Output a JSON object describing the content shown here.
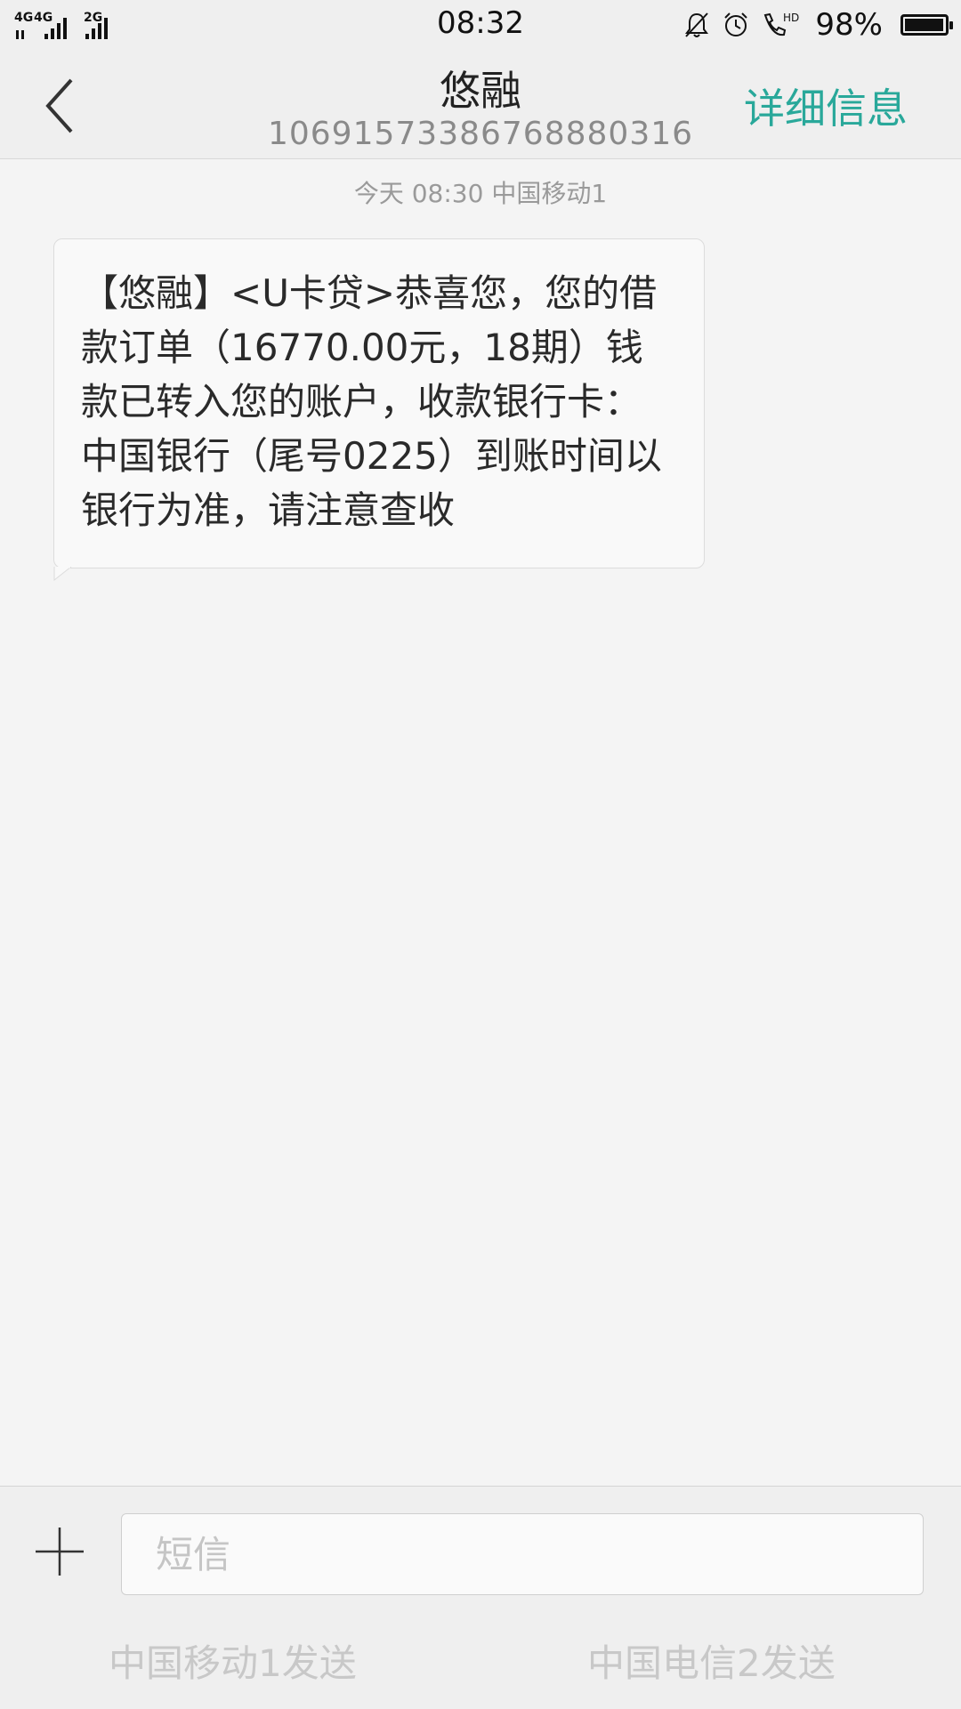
{
  "status_bar": {
    "network_1": "4G",
    "network_2": "4G",
    "network_3": "2G",
    "time": "08:32",
    "hd_label": "HD",
    "battery": "98%",
    "battery_level": 0.98
  },
  "header": {
    "title": "悠融",
    "number": "1069157338676888031​6",
    "details_label": "详细信息"
  },
  "conversation": {
    "timestamp": "今天  08:30  中国移动1",
    "messages": [
      {
        "text": "【悠融】<U卡贷>恭喜您，您的借款订单（16770.00元，18期）钱款已转入您的账户，收款银行卡：中国银行（尾号0225）到账时间以银行为准，请注意查收"
      }
    ]
  },
  "composer": {
    "placeholder": "短信",
    "send_sim1": "中国移动1发送",
    "send_sim2": "中国电信2发送"
  },
  "colors": {
    "accent": "#29a89a",
    "background": "#f4f4f4"
  },
  "icons": [
    "signal-icon",
    "mute-bell-icon",
    "alarm-icon",
    "hd-call-icon",
    "battery-icon",
    "back-arrow-icon",
    "plus-icon"
  ]
}
